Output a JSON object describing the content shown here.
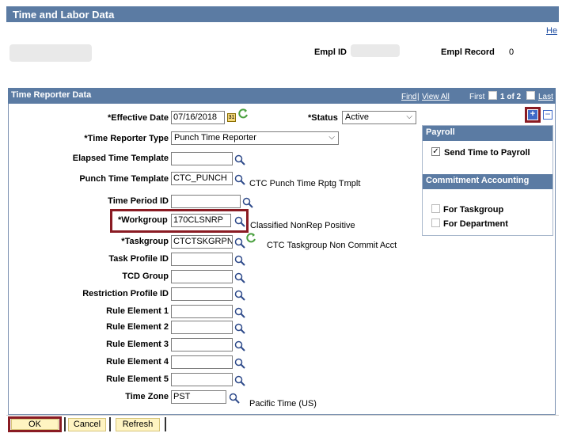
{
  "page": {
    "title": "Time and Labor Data",
    "help_link": "He"
  },
  "employee": {
    "empl_id_label": "Empl ID",
    "empl_record_label": "Empl Record",
    "empl_record_value": "0"
  },
  "section": {
    "title": "Time Reporter Data",
    "find_link": "Find",
    "view_all_link": "View All",
    "first_label": "First",
    "count": "1 of 2",
    "last_link": "Last"
  },
  "fields": {
    "effective_date": {
      "label": "*Effective Date",
      "value": "07/16/2018"
    },
    "status": {
      "label": "*Status",
      "value": "Active"
    },
    "reporter_type": {
      "label": "*Time Reporter Type",
      "value": "Punch Time Reporter"
    },
    "elapsed_template": {
      "label": "Elapsed Time Template",
      "value": ""
    },
    "punch_template": {
      "label": "Punch Time Template",
      "value": "CTC_PUNCH",
      "desc": "CTC Punch Time Rptg Tmplt"
    },
    "time_period": {
      "label": "Time Period ID",
      "value": ""
    },
    "workgroup": {
      "label": "*Workgroup",
      "value": "170CLSNRP",
      "desc": "Classified NonRep Positive"
    },
    "taskgroup": {
      "label": "*Taskgroup",
      "value": "CTCTSKGRPN",
      "desc": "CTC Taskgroup Non Commit Acct"
    },
    "task_profile": {
      "label": "Task Profile ID",
      "value": ""
    },
    "tcd_group": {
      "label": "TCD Group",
      "value": ""
    },
    "restriction_profile": {
      "label": "Restriction Profile ID",
      "value": ""
    },
    "rule1": {
      "label": "Rule Element 1",
      "value": ""
    },
    "rule2": {
      "label": "Rule Element 2",
      "value": ""
    },
    "rule3": {
      "label": "Rule Element 3",
      "value": ""
    },
    "rule4": {
      "label": "Rule Element 4",
      "value": ""
    },
    "rule5": {
      "label": "Rule Element 5",
      "value": ""
    },
    "time_zone": {
      "label": "Time Zone",
      "value": "PST",
      "desc": "Pacific Time (US)"
    }
  },
  "payroll": {
    "title": "Payroll",
    "send_time_label": "Send Time to Payroll",
    "send_time_checked": true
  },
  "commitment": {
    "title": "Commitment Accounting",
    "for_taskgroup": "For Taskgroup",
    "for_department": "For Department"
  },
  "buttons": {
    "ok": "OK",
    "cancel": "Cancel",
    "refresh": "Refresh"
  },
  "colors": {
    "header": "#5b7ba3",
    "highlight": "#8a1b23",
    "link": "#1f4ea3",
    "button": "#fff4c2"
  }
}
